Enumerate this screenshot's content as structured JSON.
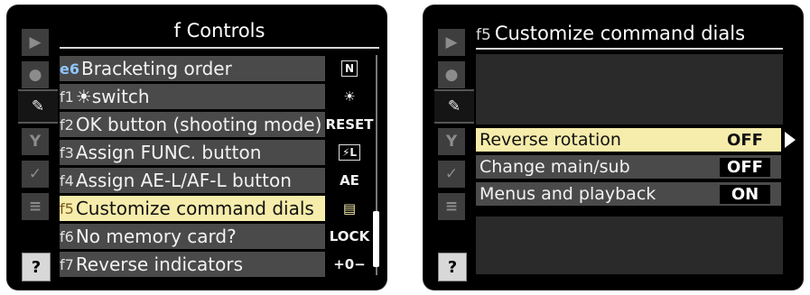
{
  "left": {
    "title": "f  Controls",
    "sidebar": [
      "▶",
      "●",
      "✎",
      "Y",
      "✓",
      "≡",
      "?"
    ],
    "items": [
      {
        "code": "e6",
        "label": "Bracketing order",
        "value": "N"
      },
      {
        "code": "f1",
        "label": "☀switch",
        "value": "☀"
      },
      {
        "code": "f2",
        "label": "OK button (shooting mode)",
        "value": "RESET"
      },
      {
        "code": "f3",
        "label": "Assign FUNC. button",
        "value": "⚡L"
      },
      {
        "code": "f4",
        "label": "Assign AE-L/AF-L button",
        "value": "AE"
      },
      {
        "code": "f5",
        "label": "Customize command dials",
        "value": "▤"
      },
      {
        "code": "f6",
        "label": "No memory card?",
        "value": "LOCK"
      },
      {
        "code": "f7",
        "label": "Reverse indicators",
        "value": "+0−"
      }
    ]
  },
  "right": {
    "title_code": "f5",
    "title": "Customize command dials",
    "sidebar": [
      "▶",
      "●",
      "✎",
      "Y",
      "✓",
      "≡",
      "?"
    ],
    "items": [
      {
        "label": "Reverse rotation",
        "value": "OFF"
      },
      {
        "label": "Change main/sub",
        "value": "OFF"
      },
      {
        "label": "Menus and playback",
        "value": "ON"
      }
    ]
  }
}
